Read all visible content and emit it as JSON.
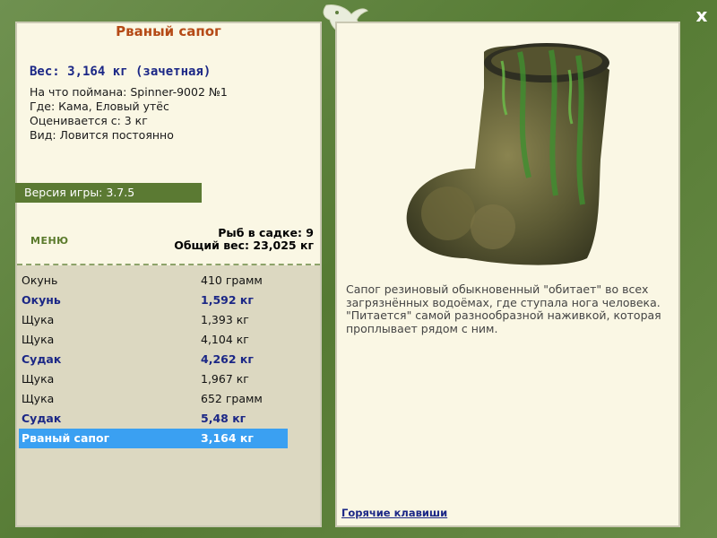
{
  "window": {
    "close_label": "x"
  },
  "fish": {
    "title": "Рваный сапог",
    "weight": "Вес: 3,164 кг (зачетная)",
    "caught_on": "На что поймана: Spinner-9002 №1",
    "location": "Где: Кама, Еловый утёс",
    "rated_from": "Оценивается с: 3 кг",
    "kind": "Вид: Ловится постоянно"
  },
  "version": "Версия игры: 3.7.5",
  "menu_label": "МЕНЮ",
  "keep_net": {
    "fish_count": "Рыб в садке: 9",
    "total_weight": "Общий вес: 23,025 кг"
  },
  "catch_list": [
    {
      "name": "Окунь",
      "weight": "410 грамм",
      "style": "plain"
    },
    {
      "name": "Окунь",
      "weight": "1,592 кг",
      "style": "trophy"
    },
    {
      "name": "Щука",
      "weight": "1,393 кг",
      "style": "plain"
    },
    {
      "name": "Щука",
      "weight": "4,104 кг",
      "style": "plain"
    },
    {
      "name": "Судак",
      "weight": "4,262 кг",
      "style": "trophy"
    },
    {
      "name": "Щука",
      "weight": "1,967 кг",
      "style": "plain"
    },
    {
      "name": "Щука",
      "weight": "652 грамм",
      "style": "plain"
    },
    {
      "name": "Судак",
      "weight": "5,48 кг",
      "style": "trophy"
    },
    {
      "name": "Рваный сапог",
      "weight": "3,164 кг",
      "style": "selected"
    }
  ],
  "description": "Сапог резиновый обыкновенный \"обитает\" во всех загрязнённых водоёмах, где ступала нога человека. \"Питается\" самой разнообразной наживкой, которая проплывает рядом с ним.",
  "hotkeys_label": "Горячие клавиши",
  "colors": {
    "frame_green": "#5f7f3e",
    "panel_bg": "#faf7e4",
    "title_orange": "#b54a16",
    "trophy_blue": "#1b2786",
    "selected_blue": "#3aa0f2"
  }
}
